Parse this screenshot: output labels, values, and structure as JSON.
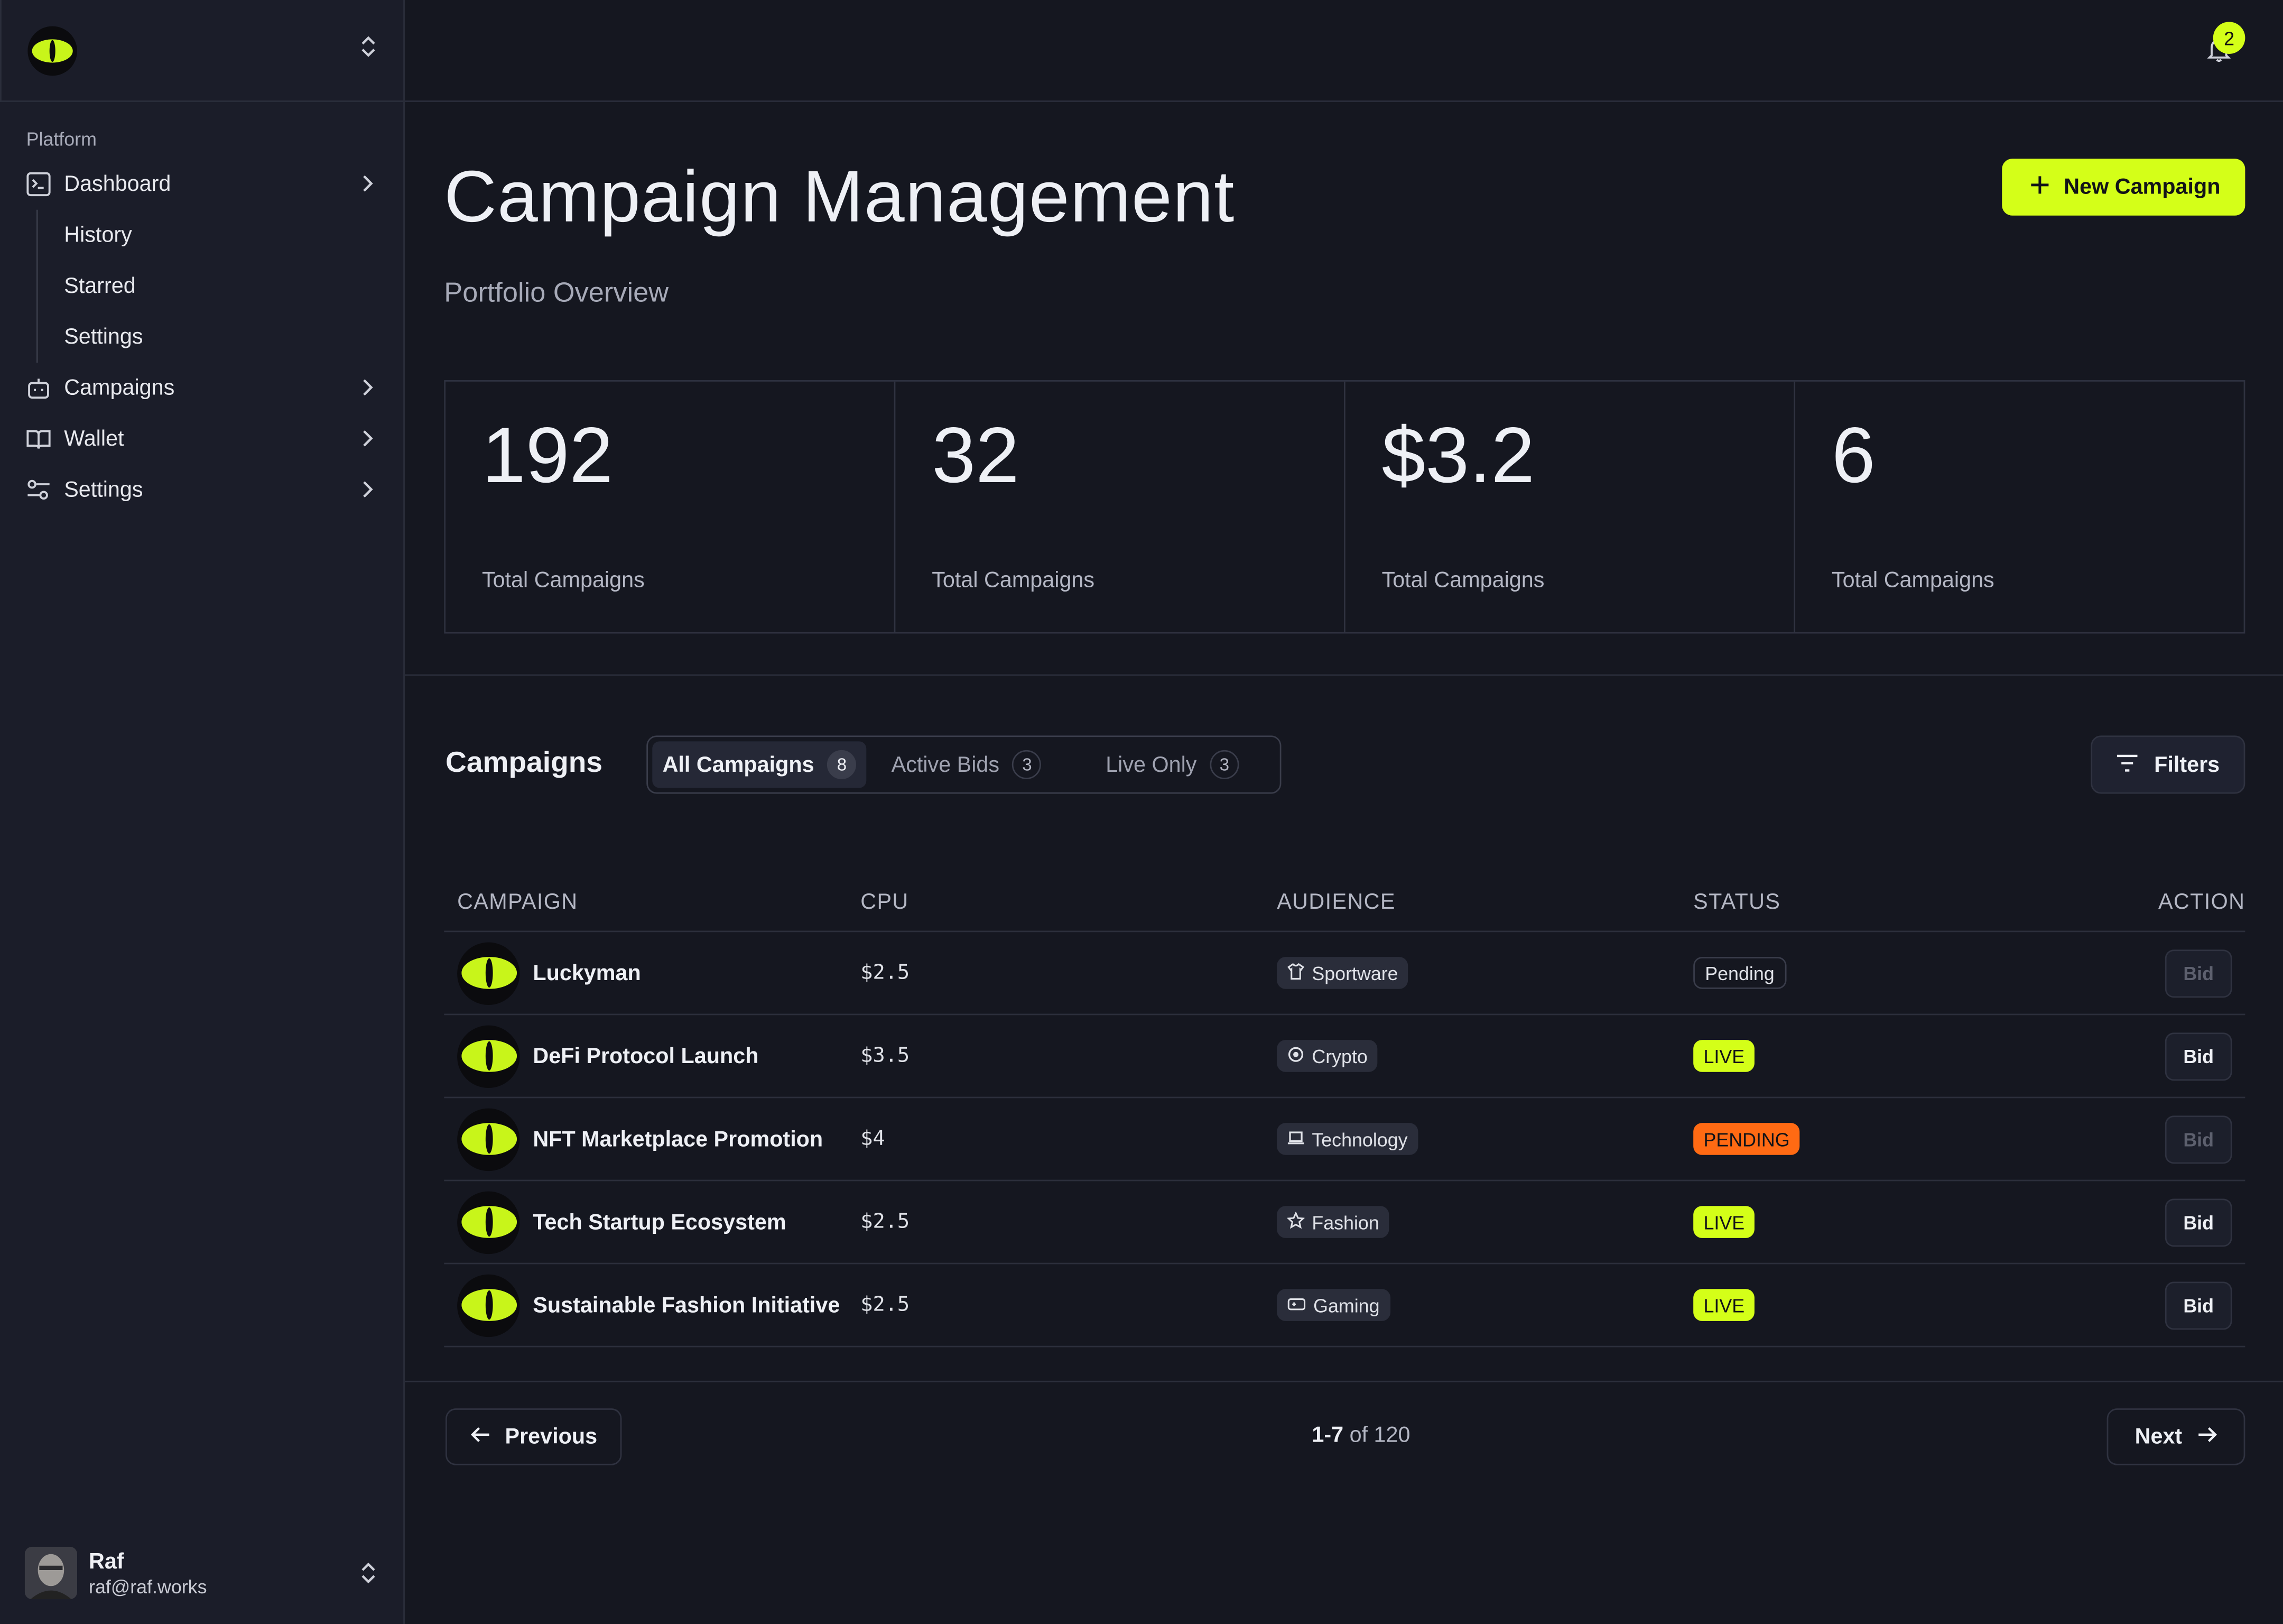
{
  "colors": {
    "accent": "#d4ff18",
    "warning": "#ff6a13",
    "background": "#151720",
    "sidebar": "#1b1d29"
  },
  "sidebar": {
    "section_label": "Platform",
    "items": [
      {
        "label": "Dashboard",
        "icon": "terminal-icon"
      },
      {
        "label": "Campaigns",
        "icon": "bot-icon"
      },
      {
        "label": "Wallet",
        "icon": "book-icon"
      },
      {
        "label": "Settings",
        "icon": "sliders-icon"
      }
    ],
    "sub_items": [
      "History",
      "Starred",
      "Settings"
    ],
    "user": {
      "name": "Raf",
      "email": "raf@raf.works"
    }
  },
  "topbar": {
    "notification_count": "2"
  },
  "header": {
    "title": "Campaign Management",
    "subtitle": "Portfolio Overview",
    "new_button": "New Campaign"
  },
  "stats": [
    {
      "value": "192",
      "label": "Total Campaigns"
    },
    {
      "value": "32",
      "label": "Total Campaigns"
    },
    {
      "value": "$3.2",
      "label": "Total Campaigns"
    },
    {
      "value": "6",
      "label": "Total Campaigns"
    }
  ],
  "campaigns": {
    "title": "Campaigns",
    "tabs": [
      {
        "label": "All Campaigns",
        "count": "8"
      },
      {
        "label": "Active Bids",
        "count": "3"
      },
      {
        "label": "Live Only",
        "count": "3"
      }
    ],
    "filters_label": "Filters",
    "columns": [
      "CAMPAIGN",
      "CPU",
      "AUDIENCE",
      "STATUS",
      "ACTION"
    ],
    "rows": [
      {
        "name": "Luckyman",
        "cpu": "$2.5",
        "audience": "Sportware",
        "audience_icon": "shirt-icon",
        "status": "Pending",
        "action": "Bid"
      },
      {
        "name": "DeFi Protocol Launch",
        "cpu": "$3.5",
        "audience": "Crypto",
        "audience_icon": "coin-icon",
        "status": "LIVE",
        "action": "Bid"
      },
      {
        "name": "NFT Marketplace Promotion",
        "cpu": "$4",
        "audience": "Technology",
        "audience_icon": "laptop-icon",
        "status": "PENDING",
        "action": "Bid"
      },
      {
        "name": "Tech Startup Ecosystem",
        "cpu": "$2.5",
        "audience": "Fashion",
        "audience_icon": "star-icon",
        "status": "LIVE",
        "action": "Bid"
      },
      {
        "name": "Sustainable Fashion Initiative",
        "cpu": "$2.5",
        "audience": "Gaming",
        "audience_icon": "gamepad-icon",
        "status": "LIVE",
        "action": "Bid"
      }
    ]
  },
  "pagination": {
    "previous": "Previous",
    "next": "Next",
    "range": "1-7",
    "of_text": "of 120"
  }
}
